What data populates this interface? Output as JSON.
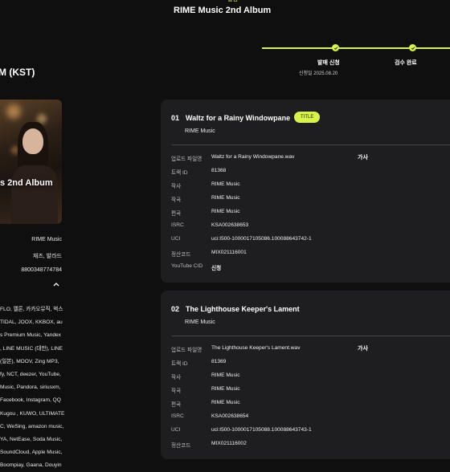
{
  "header": {
    "top_sub": "앨범",
    "album_title": "RIME Music 2nd Album"
  },
  "progress": {
    "accent": "#d8f34a",
    "steps": [
      {
        "label": "발매 신청",
        "date": "신청일 2025.08.20"
      },
      {
        "label": "검수 완료",
        "date": ""
      }
    ]
  },
  "left": {
    "release_time_suffix": "M (KST)",
    "cover_text": "s 2nd Album",
    "info_values": [
      "RIME Music",
      "재즈, 발라드",
      "8800348774784"
    ],
    "platforms": [
      "FLO, 멜론, 카카오뮤직, 벅스",
      "TIDAL, JOOX, KKBOX, au",
      "s Premium Music, Yandex",
      ", LINE MUSIC (대만), LINE",
      "(일본), MOOV, Zing MP3,",
      "fy, NCT, deezer, YouTube,",
      "Music, Pandora, siriusxm,",
      "Facebook, Instagram, QQ",
      "Kugou , KUWO, ULTIMATE",
      "C, WeSing, amazon music,",
      "YA, NetEase, Soda Music,",
      "SoundCloud, Apple Music,",
      "Boompiay, Gaana, Douyin"
    ]
  },
  "tracks": [
    {
      "num": "01",
      "title": "Waltz for a Rainy Windowpane",
      "badge": "TITLE",
      "artist": "RIME Music",
      "lyrics_label": "가사",
      "fields": [
        {
          "label": "업로드 파일명",
          "value": "Waltz for a Rainy Windowpane.wav"
        },
        {
          "label": "트랙 ID",
          "value": "81368"
        },
        {
          "label": "작사",
          "value": "RIME Music"
        },
        {
          "label": "작곡",
          "value": "RIME Music"
        },
        {
          "label": "편곡",
          "value": "RIME Music"
        },
        {
          "label": "ISRC",
          "value": "KSA002638653"
        },
        {
          "label": "UCI",
          "value": "uci:I500-1000017105086.100088643742-1"
        },
        {
          "label": "정산코드",
          "value": "MIX021116001"
        },
        {
          "label": "YouTube CID",
          "value": "신청"
        }
      ]
    },
    {
      "num": "02",
      "title": "The Lighthouse Keeper's Lament",
      "badge": "",
      "artist": "RIME Music",
      "lyrics_label": "가사",
      "fields": [
        {
          "label": "업로드 파일명",
          "value": "The Lighthouse Keeper's Lament.wav"
        },
        {
          "label": "트랙 ID",
          "value": "81369"
        },
        {
          "label": "작사",
          "value": "RIME Music"
        },
        {
          "label": "작곡",
          "value": "RIME Music"
        },
        {
          "label": "편곡",
          "value": "RIME Music"
        },
        {
          "label": "ISRC",
          "value": "KSA002638654"
        },
        {
          "label": "UCI",
          "value": "uci:I500-1000017105088.100088643743-1"
        },
        {
          "label": "정산코드",
          "value": "MIX021116002"
        }
      ]
    }
  ]
}
